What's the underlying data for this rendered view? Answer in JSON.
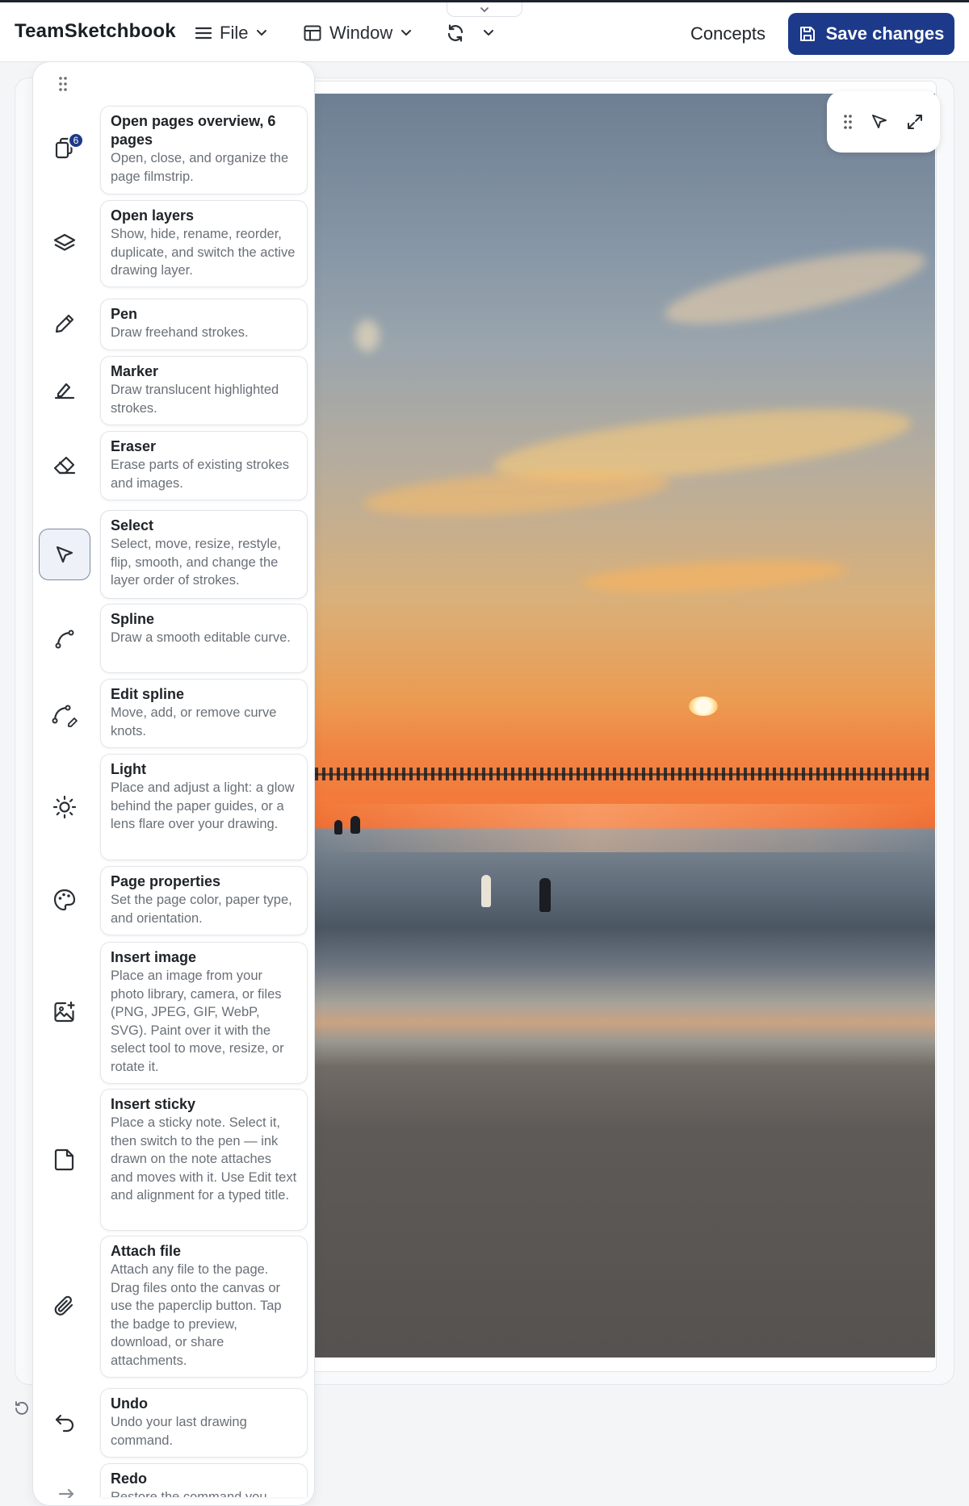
{
  "app": {
    "title": "TeamSketchbook"
  },
  "header": {
    "file_label": "File",
    "window_label": "Window",
    "concepts_label": "Concepts",
    "save_label": "Save changes"
  },
  "colors": {
    "primary": "#1d3a8a",
    "selected_tool_border": "#7a8aa6"
  },
  "pages": {
    "count": "6"
  },
  "tools": [
    {
      "icon": "pages-icon",
      "title": "Open pages overview, 6 pages",
      "desc": "Open, close, and organize the page filmstrip."
    },
    {
      "icon": "layers-icon",
      "title": "Open layers",
      "desc": "Show, hide, rename, reorder, duplicate, and switch the active drawing layer."
    },
    {
      "icon": "pen-icon",
      "title": "Pen",
      "desc": "Draw freehand strokes."
    },
    {
      "icon": "marker-icon",
      "title": "Marker",
      "desc": "Draw translucent highlighted strokes."
    },
    {
      "icon": "eraser-icon",
      "title": "Eraser",
      "desc": "Erase parts of existing strokes and images."
    },
    {
      "icon": "select-icon",
      "title": "Select",
      "desc": "Select, move, resize, restyle, flip, smooth, and change the layer order of strokes.",
      "active": true
    },
    {
      "icon": "spline-icon",
      "title": "Spline",
      "desc": "Draw a smooth editable curve."
    },
    {
      "icon": "edit-spline-icon",
      "title": "Edit spline",
      "desc": "Move, add, or remove curve knots."
    },
    {
      "icon": "light-icon",
      "title": "Light",
      "desc": "Place and adjust a light: a glow behind the paper guides, or a lens flare over your drawing."
    },
    {
      "icon": "palette-icon",
      "title": "Page properties",
      "desc": "Set the page color, paper type, and orientation."
    },
    {
      "icon": "insert-image-icon",
      "title": "Insert image",
      "desc": "Place an image from your photo library, camera, or files (PNG, JPEG, GIF, WebP, SVG). Paint over it with the select tool to move, resize, or rotate it."
    },
    {
      "icon": "sticky-note-icon",
      "title": "Insert sticky",
      "desc": "Place a sticky note. Select it, then switch to the pen — ink drawn on the note attaches and moves with it. Use Edit text and alignment for a typed title."
    },
    {
      "icon": "paperclip-icon",
      "title": "Attach file",
      "desc": "Attach any file to the page. Drag files onto the canvas or use the paperclip button. Tap the badge to preview, download, or share attachments."
    },
    {
      "icon": "undo-icon",
      "title": "Undo",
      "desc": "Undo your last drawing command."
    },
    {
      "icon": "redo-icon",
      "title": "Redo",
      "desc": "Restore the command you"
    }
  ]
}
